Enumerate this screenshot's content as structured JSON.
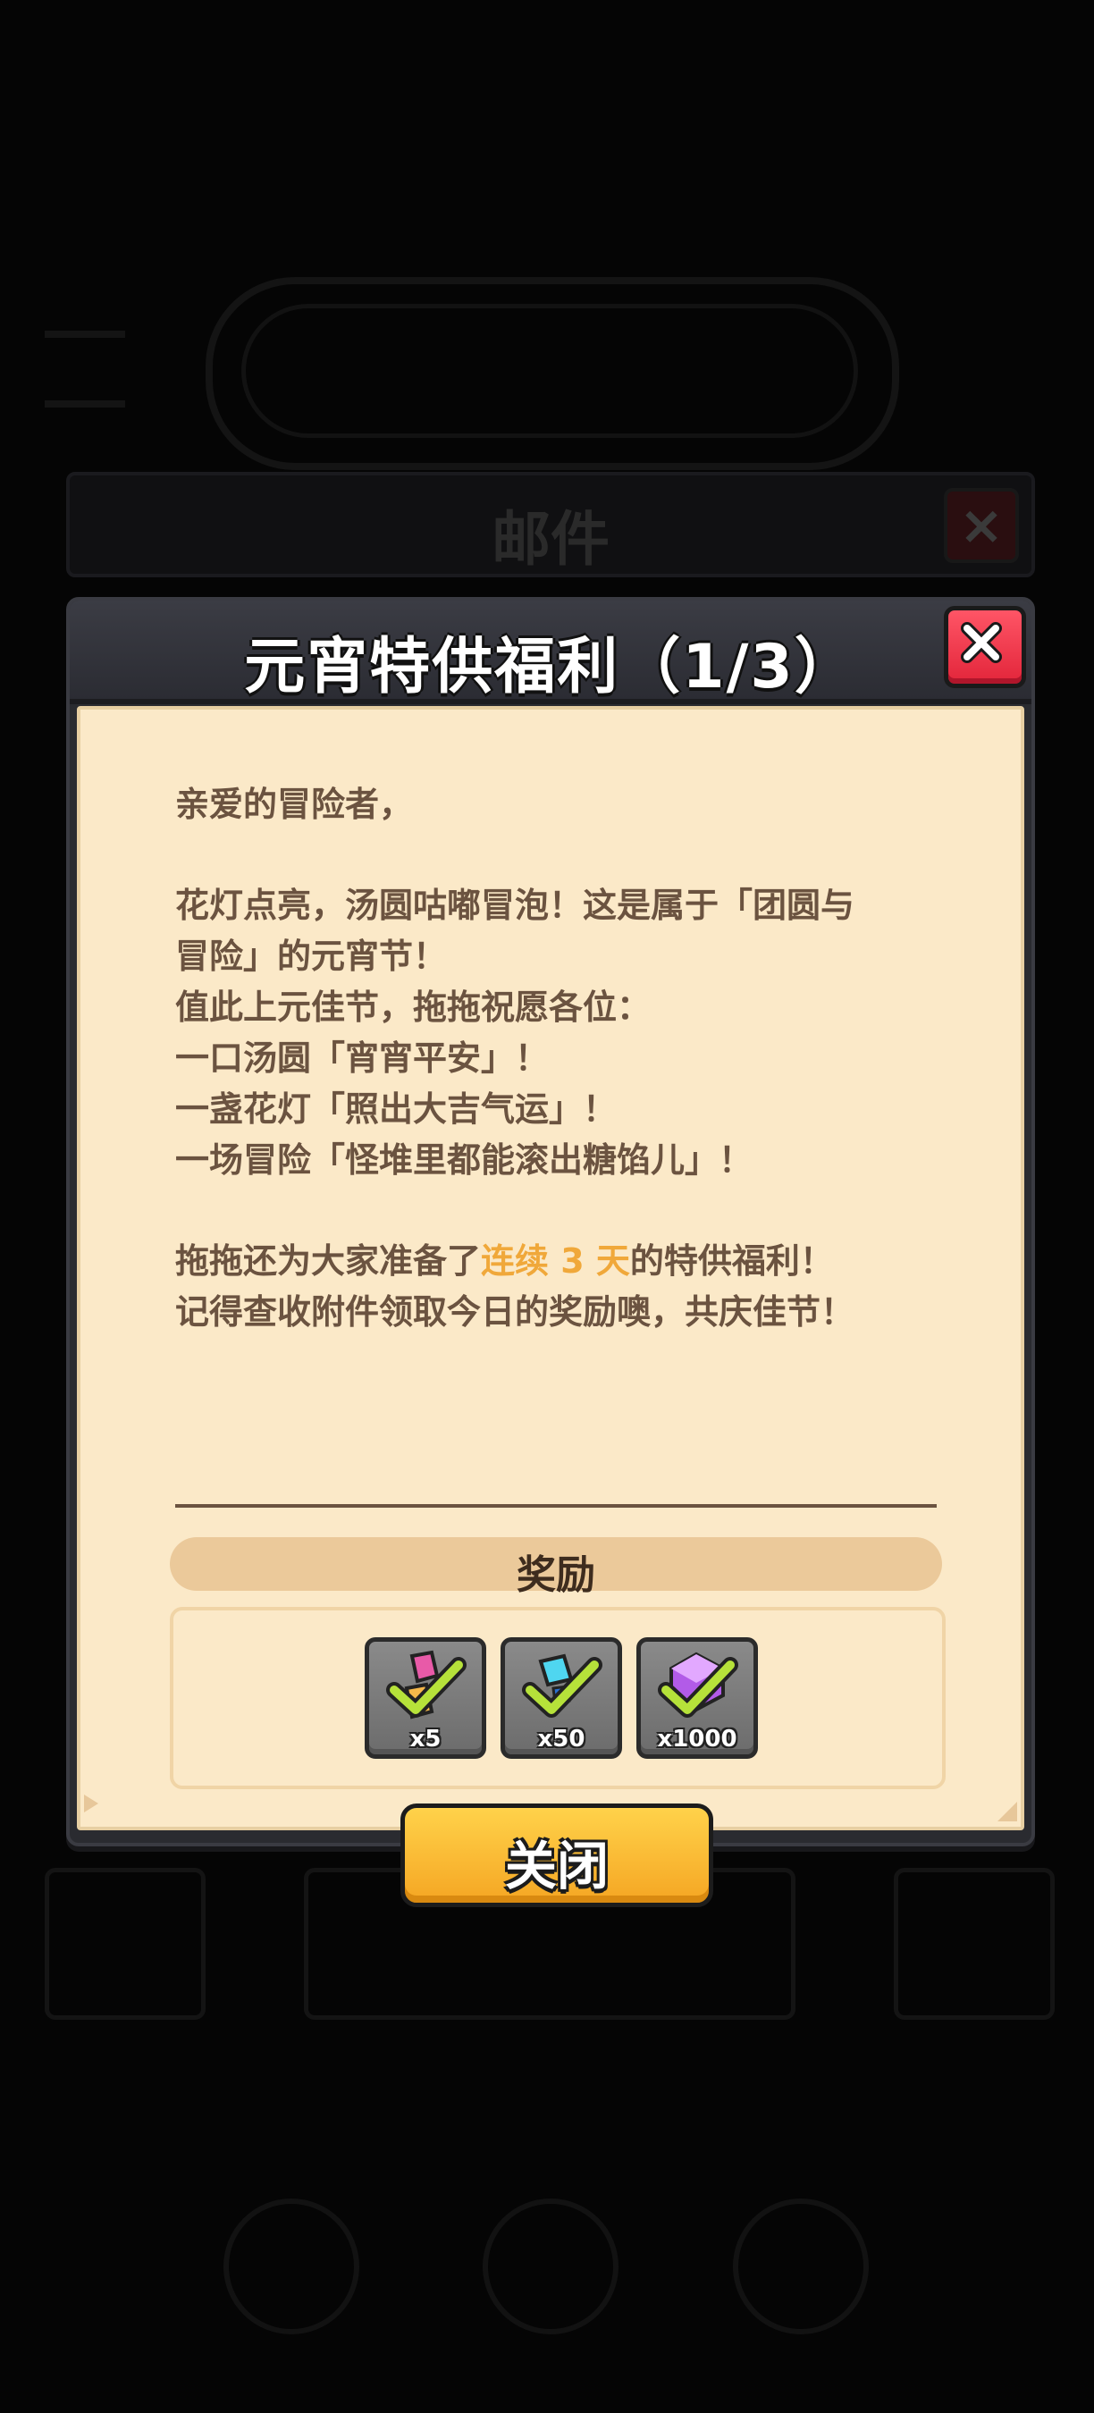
{
  "background": {
    "header_title": "邮件"
  },
  "dialog": {
    "title": "元宵特供福利（1/3）",
    "letter": {
      "greeting": "亲爱的冒险者，",
      "p1": "花灯点亮，汤圆咕嘟冒泡！这是属于「团圆与",
      "p2": "冒险」的元宵节！",
      "p3": "值此上元佳节，拖拖祝愿各位：",
      "p4": "一口汤圆「宵宵平安」！",
      "p5": "一盏花灯「照出大吉气运」！",
      "p6": "一场冒险「怪堆里都能滚出糖馅儿」！",
      "p7_pre": "拖拖还为大家准备了",
      "p7_hl": "连续 3 天",
      "p7_post": "的特供福利！",
      "p8": "记得查收附件领取今日的奖励噢，共庆佳节！"
    },
    "reward_label": "奖励",
    "rewards": [
      {
        "icon": "pink-crystal-check-icon",
        "qty": "x5"
      },
      {
        "icon": "blue-crystal-check-icon",
        "qty": "x50"
      },
      {
        "icon": "purple-gem-check-icon",
        "qty": "x1000"
      }
    ],
    "close_button": "关闭"
  },
  "colors": {
    "highlight": "#f0a83a",
    "text": "#6b5340",
    "button": "#f5a623",
    "close_red": "#e2253a"
  }
}
